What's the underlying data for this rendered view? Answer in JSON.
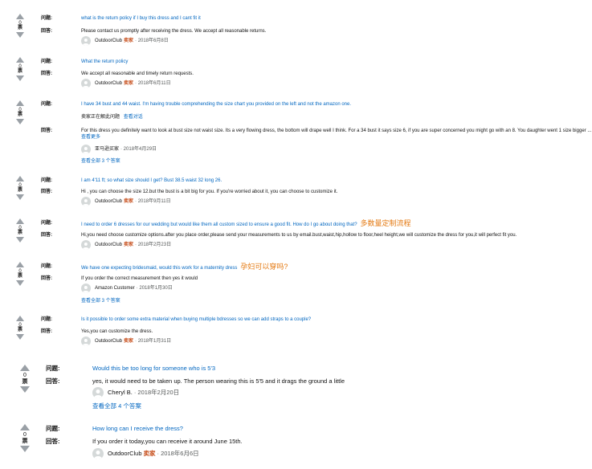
{
  "labels": {
    "question": "问题:",
    "answer": "回答:",
    "votes_word": "票"
  },
  "items": [
    {
      "votes": "0",
      "question": "what is the return policy if I buy this dress and I cant fit it",
      "answer": "Please contact us promptly after receiving the dress. We accept all reasonable returns.",
      "author": "OutdoorClub",
      "badge": "卖家",
      "date": "· 2018年6月8日"
    },
    {
      "votes": "0",
      "question": "What the return policy",
      "answer": "We accept all reasonable and timely return requests.",
      "author": "OutdoorClub",
      "badge": "卖家",
      "date": "· 2018年6月11日"
    },
    {
      "votes": "0",
      "question": "I have 34 bust and 44 waist. I'm having trouble comprehending the size chart you provided on the left and not the amazon one.",
      "seller_answering": "卖家正在解此问题",
      "view_conversation": "查看对话",
      "answer": "For this dress you definitely want to look at bust size not waist size. Its a very flowing dress, the bottom will drape well I think. For a 34 bust it says size 6, if you are super concerned you might go with an 8. You daughter went 1 size bigger ...",
      "see_more": "查看更多",
      "author": "亚马逊买家",
      "date": "· 2018年4月29日",
      "see_all": "查看全部 3 个答案"
    },
    {
      "votes": "0",
      "question": "I am 4'11 ft; so what size should I get? Bust 38.5 waist 32 long 26.",
      "answer": "Hi , you can choose the size 12.but the bust is a bit big for you. If you're worried about it, you can choose to customize it.",
      "author": "OutdoorClub",
      "badge": "卖家",
      "date": "· 2018年9月11日"
    },
    {
      "votes": "0",
      "question": "I need to order 6 dresses for our wedding but would like them all custom sized to ensure a good fit. How do I go about doing that?",
      "note": "多数量定制流程",
      "answer": "Hi,you need choose customize options.after you place order,please send your measurements to us by email.bust,waist,hip,hollow to floor,heel height,we will customize the dress for you,it will perfect fit you.",
      "author": "OutdoorClub",
      "badge": "卖家",
      "date": "· 2018年2月23日"
    },
    {
      "votes": "0",
      "question": "We have one expecting bridesmaid, would this work for a maternity dress",
      "note": "孕妇可以穿吗?",
      "answer": "If you order the correct measurement then yes it would",
      "author": "Amazon Customer",
      "date": "· 2018年1月30日",
      "see_all": "查看全部 3 个答案"
    },
    {
      "votes": "0",
      "question": "Is it possible to order some extra material when buying multiple bdresses so we can add straps to a couple?",
      "answer": "Yes,you can customize the dress.",
      "author": "OutdoorClub",
      "badge": "卖家",
      "date": "· 2018年1月31日"
    },
    {
      "votes": "0",
      "question": "Would this be too long for someone who is 5'3",
      "answer": "yes, it would need to be taken up. The person wearing this is 5'5 and it drags the ground a little",
      "author": "Cheryl B.",
      "date": "· 2018年2月20日",
      "see_all": "查看全部 4 个答案"
    },
    {
      "votes": "0",
      "question": "How long can I receive the dress?",
      "answer": "If you order it today,you can receive it around June 15th.",
      "author": "OutdoorClub",
      "badge": "卖家",
      "date": "· 2018年6月6日"
    }
  ]
}
